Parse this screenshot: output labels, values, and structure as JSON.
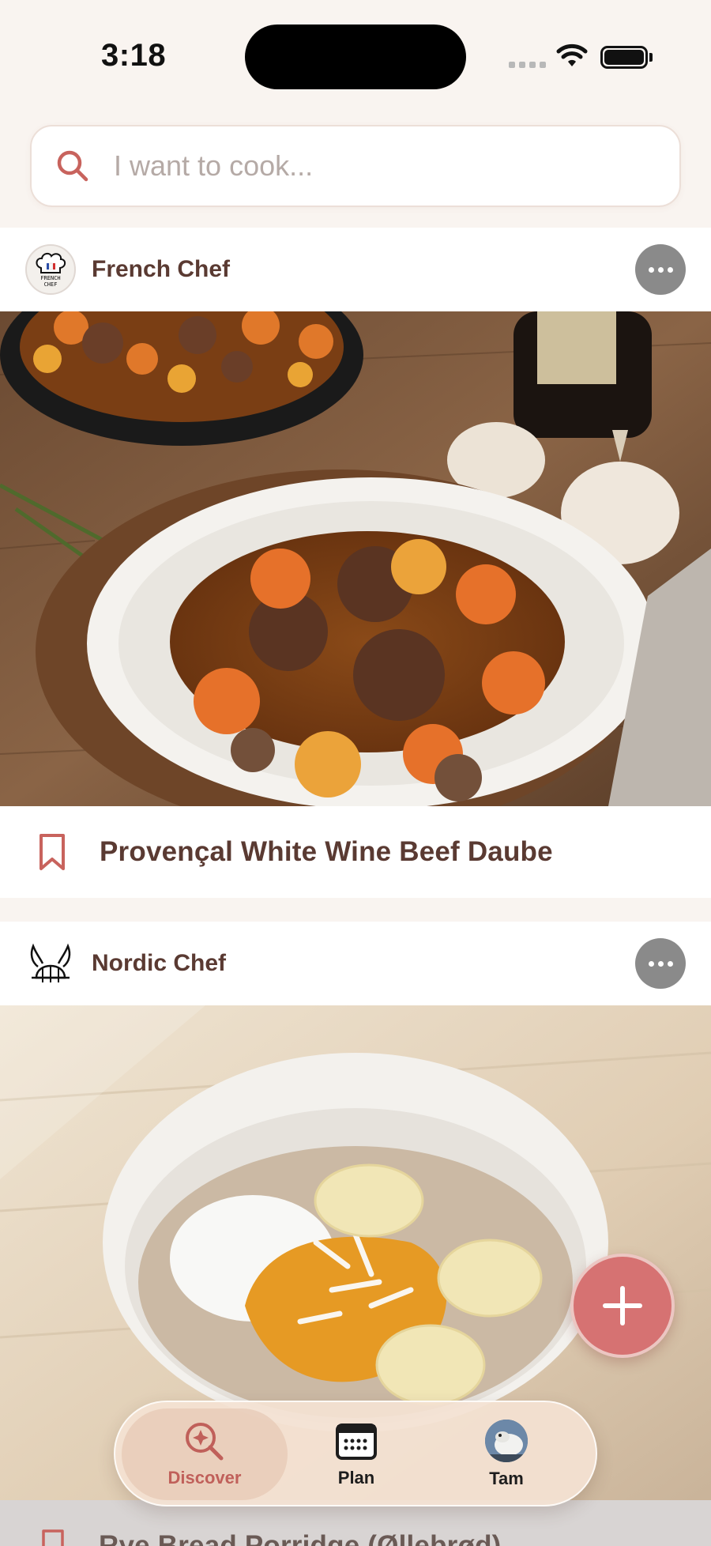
{
  "status_bar": {
    "time": "3:18"
  },
  "search": {
    "placeholder": "I want to cook..."
  },
  "feed": [
    {
      "chef": "French Chef",
      "chef_avatar_text": [
        "FRENCH",
        "CHEF"
      ],
      "recipe_title": "Provençal White Wine Beef Daube"
    },
    {
      "chef": "Nordic Chef",
      "recipe_title": "Rye Bread Porridge (Øllebrød)"
    }
  ],
  "tabs": [
    {
      "label": "Discover",
      "icon": "discover-icon",
      "active": true
    },
    {
      "label": "Plan",
      "icon": "calendar-icon",
      "active": false
    },
    {
      "label": "Tam",
      "icon": "avatar",
      "active": false
    }
  ],
  "colors": {
    "accent": "#d67272",
    "active_tab_text": "#c0605a",
    "text": "#5a3a32",
    "background": "#f9f4f0",
    "more_button": "#8a8a8a"
  }
}
